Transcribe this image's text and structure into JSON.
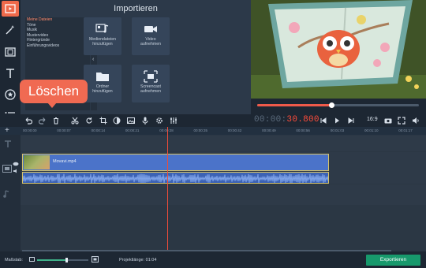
{
  "import_panel": {
    "title": "Importieren",
    "categories": [
      "Meine Dateien",
      "Töne",
      "Musik",
      "Mustervideo",
      "Hintergründe",
      "Einführungsvideos"
    ],
    "tiles": [
      {
        "label": "Mediendateien\nhinzufügen",
        "icon": "media-files-icon"
      },
      {
        "label": "Video\naufnehmen",
        "icon": "camera-icon"
      },
      {
        "label": "Ordner\nhinzufügen",
        "icon": "folder-icon"
      },
      {
        "label": "Screencast\naufnehmen",
        "icon": "screencast-icon"
      }
    ]
  },
  "tooltip": {
    "text": "Löschen"
  },
  "player": {
    "timecode_prefix": "00:00:",
    "timecode_value": "30.800",
    "ratio": "16:9",
    "progress": 0.46
  },
  "ruler": {
    "ticks": [
      "00:00:00",
      "00:00:07",
      "00:00:14",
      "00:00:21",
      "00:00:28",
      "00:00:35",
      "00:00:42",
      "00:00:49",
      "00:00:56",
      "00:01:03",
      "00:01:10",
      "00:01:17",
      "00:01:2"
    ]
  },
  "timeline": {
    "clip_name": "Movavi.mp4"
  },
  "footer": {
    "scale_label": "Maßstab:",
    "project_label": "Projektlänge:  01:04",
    "zoom_level": 0.55,
    "export_label": "Exportieren"
  },
  "colors": {
    "accent": "#ef6a4b",
    "playhead": "#ef4c3a",
    "export": "#17996c",
    "clip": "#4b73c9"
  }
}
